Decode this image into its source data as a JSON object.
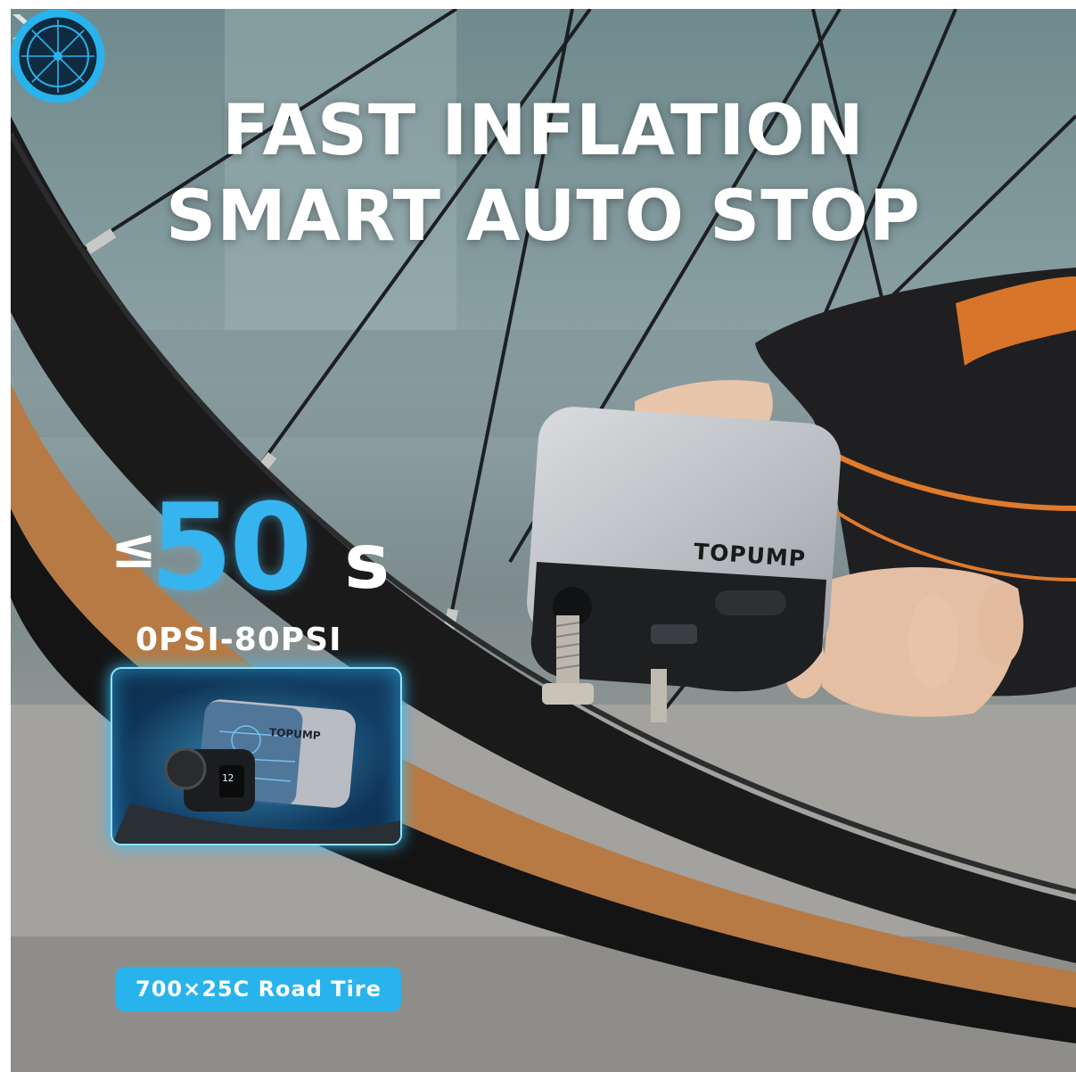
{
  "headline": {
    "line1": "FAST INFLATION",
    "line2": "SMART AUTO STOP"
  },
  "stats": {
    "comparator": "≤",
    "time_value": "50",
    "time_unit": "s",
    "pressure_range": "0PSI-80PSI"
  },
  "product": {
    "brand": "TOPUMP"
  },
  "tire_badge": "700×25C Road Tire",
  "colors": {
    "accent_blue": "#35b4ef",
    "badge_blue": "#29b3ec",
    "tire_tan": "#b77a44",
    "pump_silver": "#b9bcc2"
  }
}
